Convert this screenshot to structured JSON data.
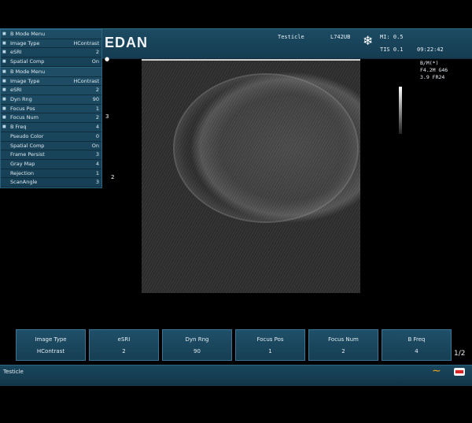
{
  "header": {
    "brand": "EDAN",
    "exam": "Testicle",
    "probe": "L742UB",
    "mi": "MI: 0.5",
    "tis": "TIS 0.1",
    "time": "09:22:42"
  },
  "menu_top": {
    "items": [
      {
        "label": "B Mode Menu",
        "value": ""
      },
      {
        "label": "Image Type",
        "value": "HContrast"
      },
      {
        "label": "eSRI",
        "value": "2"
      },
      {
        "label": "Spatial Comp",
        "value": "On"
      }
    ]
  },
  "menu_main": {
    "items": [
      {
        "label": "B Mode Menu",
        "value": ""
      },
      {
        "label": "Image Type",
        "value": "HContrast"
      },
      {
        "label": "eSRI",
        "value": "2"
      },
      {
        "label": "Dyn Rng",
        "value": "90"
      },
      {
        "label": "Focus Pos",
        "value": "1"
      },
      {
        "label": "Focus Num",
        "value": "2"
      },
      {
        "label": "B Freq",
        "value": "4"
      },
      {
        "label": "Pseudo Color",
        "value": "0"
      },
      {
        "label": "Spatial Comp",
        "value": "On"
      },
      {
        "label": "Frame Persist",
        "value": "3"
      },
      {
        "label": "Gray Map",
        "value": "4"
      },
      {
        "label": "Rejection",
        "value": "1"
      },
      {
        "label": "ScanAngle",
        "value": "3"
      }
    ]
  },
  "image_params": {
    "line1": "B/M(*)",
    "line2": "F4.2M  G46",
    "line3": "3.9    FR24"
  },
  "markers": {
    "m1": "3",
    "m2": "2"
  },
  "softkeys": [
    {
      "label": "Image Type",
      "value": "HContrast"
    },
    {
      "label": "eSRI",
      "value": "2"
    },
    {
      "label": "Dyn Rng",
      "value": "90"
    },
    {
      "label": "Focus Pos",
      "value": "1"
    },
    {
      "label": "Focus Num",
      "value": "2"
    },
    {
      "label": "B Freq",
      "value": "4"
    }
  ],
  "pager": "1/2",
  "status": {
    "text": "Testicle"
  }
}
